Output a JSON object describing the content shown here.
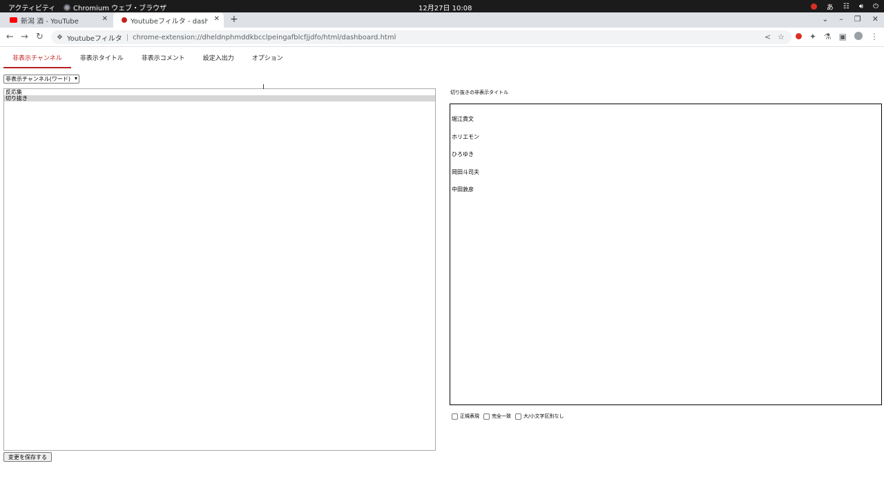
{
  "os_bar": {
    "activities": "アクティビティ",
    "app_name": "Chromium ウェブ・ブラウザ",
    "clock": "12月27日  10:08",
    "input_method": "あ"
  },
  "browser": {
    "tabs": [
      {
        "title": "新潟 酒 - YouTube",
        "active": false
      },
      {
        "title": "Youtubeフィルタ - dashbo",
        "active": true
      }
    ],
    "new_tab": "+",
    "omnibox": {
      "ext_name": "Youtubeフィルタ",
      "separator": "|",
      "url": "chrome-extension://dheldnphmddkbcclpeingafblcfjjdfo/html/dashboard.html"
    }
  },
  "dashboard": {
    "tabs": [
      "非表示チャンネル",
      "非表示タイトル",
      "非表示コメント",
      "設定入出力",
      "オプション"
    ],
    "active_tab": "非表示チャンネル",
    "mode_select_value": "非表示チャンネル(ワード)",
    "list_items": [
      "反応集",
      "切り抜き"
    ],
    "selected_list_item": "切り抜き",
    "save_button": "変更を保存する",
    "right_title": "切り抜きの非表示タイトル",
    "hidden_titles": [
      "堀江貴文",
      "ホリエモン",
      "ひろゆき",
      "岡田斗司夫",
      "中田敦彦"
    ],
    "options": [
      {
        "label": "正規表現",
        "checked": false
      },
      {
        "label": "完全一致",
        "checked": false
      },
      {
        "label": "大/小文字区別なし",
        "checked": false
      }
    ]
  },
  "colors": {
    "accent": "#c5221f",
    "tab_strip": "#dee1e6",
    "os_bar": "#1b1b1b"
  }
}
